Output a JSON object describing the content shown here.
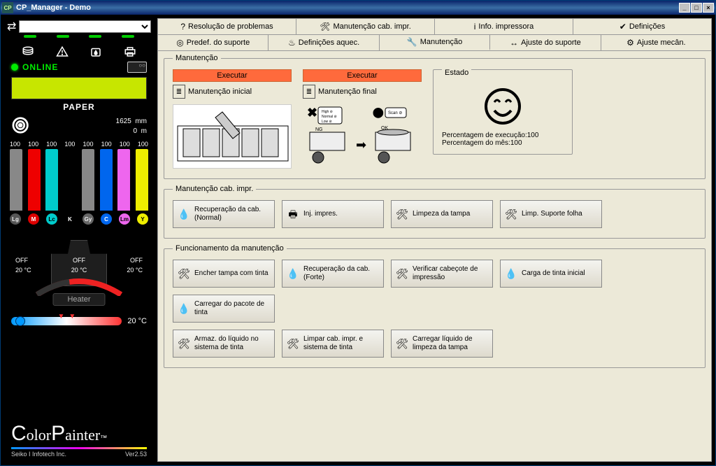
{
  "window": {
    "title": "CP_Manager - Demo"
  },
  "tabs_row1": [
    {
      "icon": "?",
      "label": "Resolução de problemas"
    },
    {
      "icon": "🛠",
      "label": "Manutenção cab. impr."
    },
    {
      "icon": "i",
      "label": "Info. impressora"
    },
    {
      "icon": "✔",
      "label": "Definições"
    }
  ],
  "tabs_row2": [
    {
      "icon": "◎",
      "label": "Predef. do suporte"
    },
    {
      "icon": "♨",
      "label": "Definições aquec."
    },
    {
      "icon": "🔧",
      "label": "Manutenção",
      "active": true
    },
    {
      "icon": "↔",
      "label": "Ajuste do suporte"
    },
    {
      "icon": "⚙",
      "label": "Ajuste mecân."
    }
  ],
  "status": {
    "online": "ONLINE",
    "paper": "PAPER",
    "roll_width": "1625",
    "roll_width_unit": "mm",
    "roll_len": "0",
    "roll_len_unit": "m"
  },
  "ink": {
    "levels": [
      "100",
      "100",
      "100",
      "100",
      "100",
      "100",
      "100",
      "100"
    ],
    "colors": [
      "#888",
      "#e00",
      "#0cc",
      "#000",
      "#888",
      "#06e",
      "#e6e",
      "#ee0"
    ],
    "labels": [
      "Lg",
      "M",
      "Lc",
      "K",
      "Gy",
      "C",
      "Lm",
      "Y"
    ],
    "dot_bg": [
      "#555",
      "#d00",
      "#0cc",
      "#000",
      "#666",
      "#06e",
      "#e6e",
      "#ee0"
    ],
    "dot_fg": [
      "#eee",
      "#fff",
      "#000",
      "#fff",
      "#eee",
      "#fff",
      "#000",
      "#000"
    ]
  },
  "heater": {
    "left_state": "OFF",
    "center_state": "OFF",
    "right_state": "OFF",
    "left_temp": "20 °C",
    "center_temp": "20 °C",
    "right_temp": "20 °C",
    "label": "Heater",
    "slider_temp": "20 °C"
  },
  "logo": {
    "brand": "ColorPainter",
    "company": "Seiko I Infotech Inc.",
    "version": "Ver2.53"
  },
  "maint": {
    "legend": "Manutenção",
    "exec": "Executar",
    "initial": "Manutenção inicial",
    "final": "Manutenção final",
    "estado_legend": "Estado",
    "pct_exec": "Percentagem de execução:100",
    "pct_month": "Percentagem do mês:100"
  },
  "cab": {
    "legend": "Manutenção cab. impr.",
    "b1": "Recuperação da cab. (Normal)",
    "b2": "Inj. impres.",
    "b3": "Limpeza da tampa",
    "b4": "Limp. Suporte folha"
  },
  "func": {
    "legend": "Funcionamento da manutenção",
    "b1": "Encher tampa com tinta",
    "b2": "Recuperação da cab. (Forte)",
    "b3": "Verificar cabeçote de impressão",
    "b4": "Carga de tinta inicial",
    "b5": "Carregar do pacote de tinta",
    "b6": "Armaz. do líquido no sistema de tinta",
    "b7": "Limpar cab. impr. e sistema de tinta",
    "b8": "Carregar líquido de limpeza da tampa"
  }
}
